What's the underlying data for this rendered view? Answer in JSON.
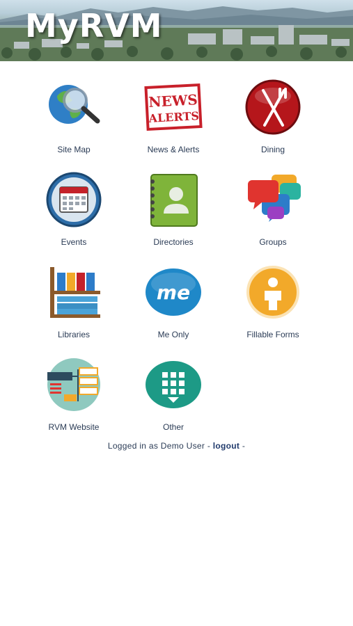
{
  "header": {
    "logo": "MyRVM"
  },
  "tiles": [
    {
      "label": "Site Map",
      "icon": "globe-magnifier-icon"
    },
    {
      "label": "News & Alerts",
      "icon": "news-alerts-stamp-icon",
      "stamp_line1": "NEWS",
      "stamp_line2": "ALERTS"
    },
    {
      "label": "Dining",
      "icon": "fork-knife-icon"
    },
    {
      "label": "Events",
      "icon": "calendar-icon"
    },
    {
      "label": "Directories",
      "icon": "address-book-icon"
    },
    {
      "label": "Groups",
      "icon": "chat-bubbles-icon"
    },
    {
      "label": "Libraries",
      "icon": "bookshelf-icon"
    },
    {
      "label": "Me Only",
      "icon": "me-badge-icon",
      "badge_text": "me"
    },
    {
      "label": "Fillable Forms",
      "icon": "person-circle-icon"
    },
    {
      "label": "RVM Website",
      "icon": "sitemap-circle-icon"
    },
    {
      "label": "Other",
      "icon": "app-grid-icon"
    }
  ],
  "status": {
    "logged_in_text": "Logged in as Demo User - ",
    "logout_label": "logout",
    "trailing": " -"
  },
  "colors": {
    "label_text": "#2a3b55",
    "link": "#203a6c",
    "dining_red": "#b5161b",
    "events_blue": "#2d6da8",
    "directories_green": "#7fb43a",
    "me_blue": "#1f88c8",
    "forms_orange": "#f2a92a",
    "other_teal": "#1d9a86"
  }
}
